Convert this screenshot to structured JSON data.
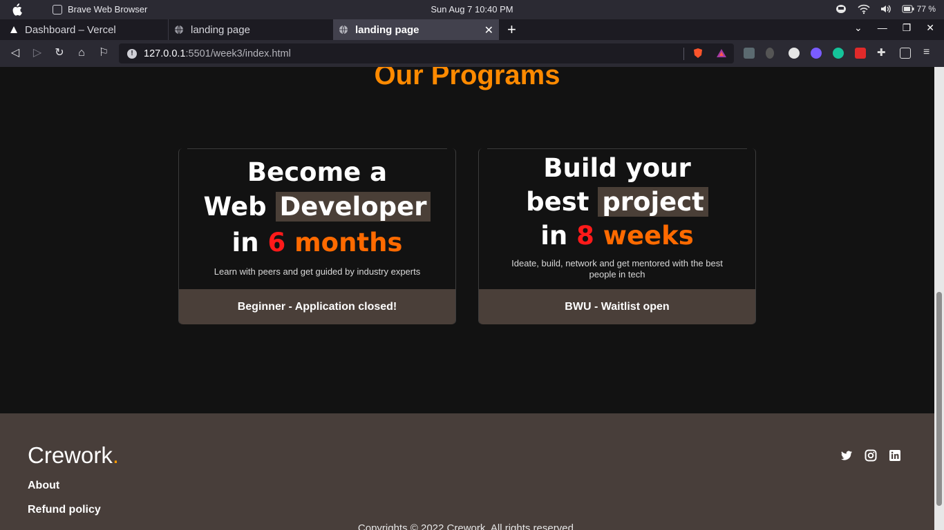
{
  "os": {
    "app_name": "Brave Web Browser",
    "clock": "Sun Aug 7  10:40 PM",
    "battery": "77 %"
  },
  "tabs": [
    {
      "label": "Dashboard – Vercel"
    },
    {
      "label": "landing page"
    },
    {
      "label": "landing page",
      "active": true
    }
  ],
  "address": {
    "host": "127.0.0.1",
    "rest": ":5501/week3/index.html"
  },
  "page": {
    "heading": "Our Programs",
    "cards": [
      {
        "line1": "Become a",
        "line2_a": "Web",
        "line2_b": "Developer",
        "line3_a": "in",
        "line3_num": "6",
        "line3_b": "months",
        "subtitle": "Learn with peers and get guided by industry experts",
        "footer": "Beginner - Application closed!"
      },
      {
        "line1": "Build your",
        "line2_a": "best",
        "line2_b": "project",
        "line3_a": "in",
        "line3_num": "8",
        "line3_b": "weeks",
        "subtitle": "Ideate, build, network and get mentored with the best people in tech",
        "footer": "BWU - Waitlist open"
      }
    ],
    "footer": {
      "brand": "Crework",
      "brand_dot": ".",
      "links": [
        "About",
        "Refund policy"
      ],
      "copyright": "Copyrights © 2022 Crework. All rights reserved."
    }
  },
  "colors": {
    "accent_orange": "#ff8a00",
    "number_red": "#ff1a1a",
    "footer_bg": "#483e3a"
  }
}
